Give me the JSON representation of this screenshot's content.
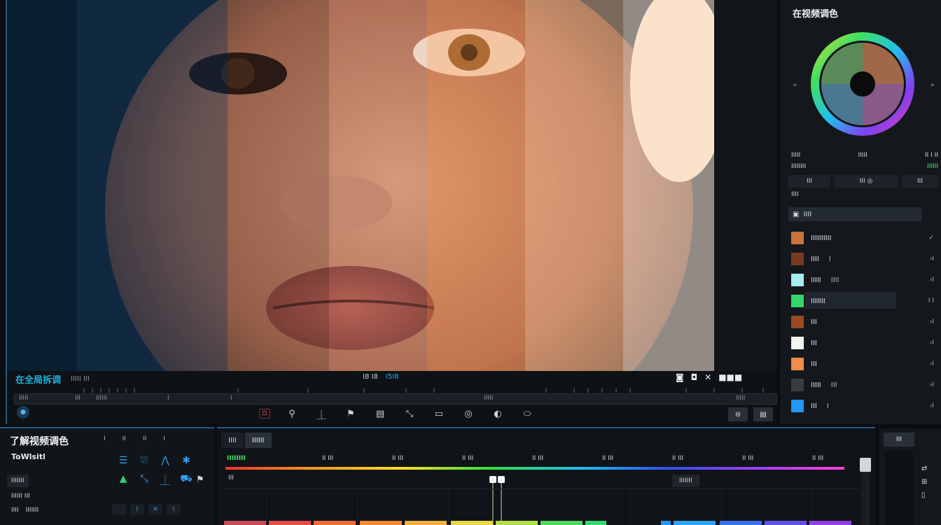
{
  "viewer": {
    "title": "在全局拆调",
    "subtitle": "ⅠⅠⅠⅠⅠ ⅠⅠⅠ",
    "timecode": "Ⅰ8 Ⅰ8",
    "timecode_accent": "Ⅰ5Ⅰ8",
    "view_controls": [
      "◙",
      "◘",
      "✕",
      "■■■"
    ],
    "scrub_labels": [
      "ⅠⅠⅠⅠⅠ",
      "ⅠⅠⅠ",
      "ⅠⅠⅠⅠⅠⅠ",
      "Ⅰ",
      "Ⅰ",
      "ⅠⅠⅠⅠⅠ",
      "ⅠⅠⅠⅠⅠ"
    ],
    "play_icon": "●",
    "tools": [
      "⊡",
      "⚲",
      "⏊",
      "⚑",
      "▤",
      "⤡",
      "▭",
      "◎",
      "◐",
      "⬭"
    ],
    "tools_right": [
      "⊜",
      "▤"
    ]
  },
  "color_panel": {
    "title": "在视频调色",
    "wheel_meta": [
      {
        "left": "ⅠⅠⅠⅠⅠ",
        "mid": "ⅠⅠⅠⅠⅠ",
        "right": "ⅠⅠ Ⅰ ⅠⅠ"
      },
      {
        "left": "ⅠⅠⅠⅠⅠⅠⅠⅠ",
        "mid": "",
        "right": "ⅠⅠⅠⅠⅠⅠ"
      }
    ],
    "buttons": [
      "ⅠⅠⅠ",
      "ⅠⅠⅠ ◎",
      "ⅠⅠⅠ"
    ],
    "section_label": "ⅠⅠⅠⅠ",
    "layer_head": "ⅠⅠⅠⅠ",
    "swatches": [
      {
        "label": "ⅠⅠⅠⅠⅠⅠⅠⅠⅠⅠ",
        "extra": "",
        "right": "✓",
        "color": "#c9733a"
      },
      {
        "label": "ⅠⅠⅠⅠ",
        "extra": "Ⅰ",
        "right": "›Ⅰ",
        "color": "#7a3a20"
      },
      {
        "label": "ⅠⅠⅠⅠⅠ",
        "extra": "ⅠⅠⅠⅠ",
        "right": "›Ⅰ",
        "color": "#a6ecef"
      },
      {
        "label": "ⅠⅠⅠⅠⅠⅠⅠ",
        "extra": "",
        "right": "Ⅰ Ⅰ",
        "color": "#33d768"
      },
      {
        "label": "ⅠⅠⅠ",
        "extra": "",
        "right": "›Ⅰ",
        "color": "#9a4a20"
      },
      {
        "label": "ⅠⅠⅠ",
        "extra": "",
        "right": "›Ⅰ",
        "color": "#f3f3f0"
      },
      {
        "label": "ⅠⅠⅠ",
        "extra": "",
        "right": "›Ⅰ",
        "color": "#f08c4a"
      },
      {
        "label": "ⅠⅠⅠⅠⅠ",
        "extra": "ⅠⅠⅠ",
        "right": "›Ⅰ",
        "color": "#3a3d40"
      },
      {
        "label": "ⅠⅠⅠ",
        "extra": "Ⅰ",
        "right": "›Ⅰ",
        "color": "#2196f3"
      }
    ]
  },
  "left_panel": {
    "title": "了解视频调色",
    "subtitle": "ToWlsitl",
    "mini": [
      "Ⅰ",
      "ⅠⅠ",
      "ⅠⅠ",
      "Ⅰ"
    ],
    "chip": "ⅠⅠⅠⅠⅠⅠⅠ",
    "row1": "ⅠⅠⅠⅠⅠⅠ ⅠⅠⅠ",
    "row2": [
      "ⅠⅠⅠⅠ",
      "ⅠⅠⅠⅠⅠⅠⅠ"
    ],
    "icons": [
      "☰",
      "⛆",
      "⋀",
      "✱",
      "▲",
      "⤡",
      "⏊",
      "⛟",
      "⚑"
    ],
    "bottom": [
      "",
      "Ⅰ",
      "✕",
      "Ⅰ"
    ]
  },
  "timeline": {
    "tabs": [
      "ⅠⅠⅠⅠ",
      "ⅠⅠⅠⅠⅠⅠ"
    ],
    "marks": [
      "ⅠⅠⅠⅠⅠⅠⅠⅠ",
      "ⅠⅠ ⅠⅠⅠ",
      "ⅠⅠ ⅠⅠⅠ",
      "ⅠⅠ ⅠⅠⅠ",
      "ⅠⅠ ⅠⅠⅠ",
      "ⅠⅠ ⅠⅠⅠ",
      "ⅠⅠ ⅠⅠⅠ",
      "ⅠⅠ ⅠⅠⅠ",
      "ⅠⅠ ⅠⅠⅠ"
    ],
    "track_label": "ⅠⅠⅠ",
    "playhead_box": "ⅠⅠⅠⅠⅠⅠⅠ",
    "clip_colors": [
      "#c54a5a",
      "#e84a4a",
      "#f06a3a",
      "#f08a3a",
      "#f0b040",
      "#e8d848",
      "#b0e048",
      "#50d860",
      "#38d870",
      "#2196f3",
      "#30a0f0",
      "#3870f0",
      "#6050e8",
      "#9040e0"
    ]
  },
  "mini_panel": {
    "head": "ⅠⅠⅠ",
    "icons": [
      "⇄",
      "⊞",
      "▯"
    ]
  }
}
